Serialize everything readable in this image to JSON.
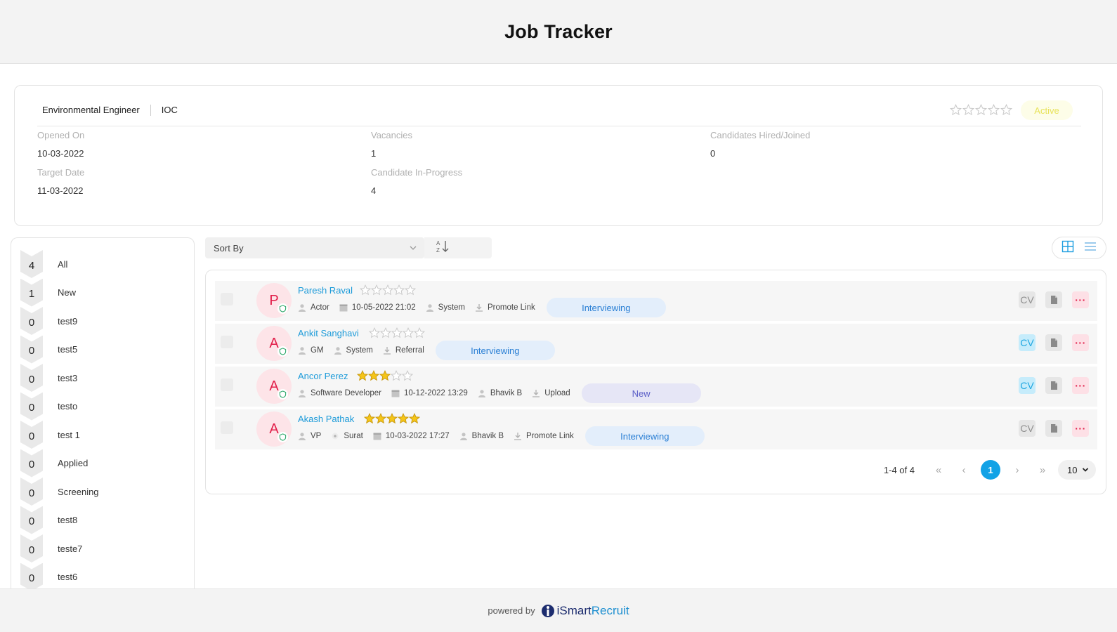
{
  "page": {
    "title": "Job Tracker"
  },
  "job": {
    "title": "Environmental Engineer",
    "org": "IOC",
    "rating": 0,
    "status": "Active",
    "fields": {
      "opened_label": "Opened On",
      "opened_value": "10-03-2022",
      "target_label": "Target Date",
      "target_value": "11-03-2022",
      "vacancies_label": "Vacancies",
      "vacancies_value": "1",
      "inprogress_label": "Candidate In-Progress",
      "inprogress_value": "4",
      "hired_label": "Candidates Hired/Joined",
      "hired_value": "0"
    }
  },
  "stages": [
    {
      "count": "4",
      "label": "All"
    },
    {
      "count": "1",
      "label": "New"
    },
    {
      "count": "0",
      "label": "test9"
    },
    {
      "count": "0",
      "label": "test5"
    },
    {
      "count": "0",
      "label": "test3"
    },
    {
      "count": "0",
      "label": "testo"
    },
    {
      "count": "0",
      "label": "test 1"
    },
    {
      "count": "0",
      "label": "Applied"
    },
    {
      "count": "0",
      "label": "Screening"
    },
    {
      "count": "0",
      "label": "test8"
    },
    {
      "count": "0",
      "label": "teste7"
    },
    {
      "count": "0",
      "label": "test6"
    }
  ],
  "toolbar": {
    "sort_label": "Sort By"
  },
  "candidates": [
    {
      "initial": "P",
      "name": "Paresh Raval",
      "rating": 0,
      "meta": [
        {
          "icon": "person-icon",
          "text": "Actor"
        },
        {
          "icon": "calendar-icon",
          "text": "10-05-2022 21:02"
        },
        {
          "icon": "person-icon",
          "text": "System"
        },
        {
          "icon": "download-icon",
          "text": "Promote Link"
        }
      ],
      "status": "Interviewing",
      "cv_available": false
    },
    {
      "initial": "A",
      "name": "Ankit Sanghavi",
      "rating": 0,
      "meta": [
        {
          "icon": "person-icon",
          "text": "GM"
        },
        {
          "icon": "person-icon",
          "text": "System"
        },
        {
          "icon": "download-icon",
          "text": "Referral"
        }
      ],
      "status": "Interviewing",
      "cv_available": true
    },
    {
      "initial": "A",
      "name": "Ancor Perez",
      "rating": 3,
      "meta": [
        {
          "icon": "person-icon",
          "text": "Software Developer"
        },
        {
          "icon": "calendar-icon",
          "text": "10-12-2022 13:29"
        },
        {
          "icon": "person-icon",
          "text": "Bhavik B"
        },
        {
          "icon": "download-icon",
          "text": "Upload"
        }
      ],
      "status": "New",
      "cv_available": true
    },
    {
      "initial": "A",
      "name": "Akash Pathak",
      "rating": 5,
      "meta": [
        {
          "icon": "person-icon",
          "text": "VP"
        },
        {
          "icon": "location-icon",
          "text": "Surat"
        },
        {
          "icon": "calendar-icon",
          "text": "10-03-2022 17:27"
        },
        {
          "icon": "person-icon",
          "text": "Bhavik B"
        },
        {
          "icon": "download-icon",
          "text": "Promote Link"
        }
      ],
      "status": "Interviewing",
      "cv_available": false
    }
  ],
  "actions": {
    "cv_label": "CV",
    "more_label": "···"
  },
  "pagination": {
    "info": "1-4 of 4",
    "current": "1",
    "page_size": "10"
  },
  "footer": {
    "powered_by": "powered by",
    "brand_part1": "iSmart",
    "brand_part2": "Recruit"
  },
  "colors": {
    "accent": "#12a2e6",
    "link": "#1d9bd9",
    "star": "#f5c518",
    "danger": "#e11d48"
  }
}
